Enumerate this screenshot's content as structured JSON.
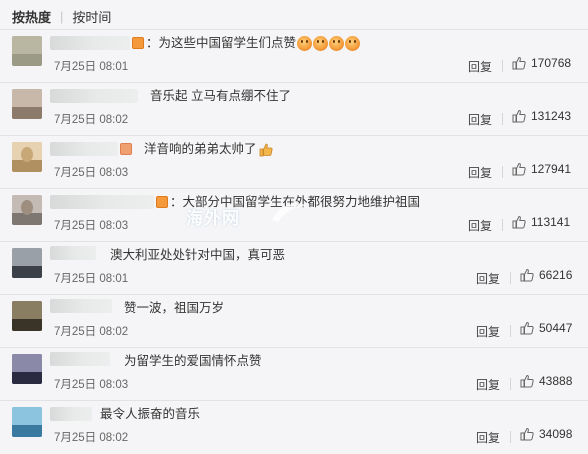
{
  "sort": {
    "hot_label": "按热度",
    "separator": "|",
    "time_label": "按时间"
  },
  "watermark": "海外网",
  "comments": [
    {
      "text": "：为这些中国留学生们点赞",
      "date": "7月25日",
      "time": "08:01",
      "reply": "回复",
      "likes": "170768"
    },
    {
      "text": "音乐起 立马有点绷不住了",
      "date": "7月25日",
      "time": "08:02",
      "reply": "回复",
      "likes": "131243"
    },
    {
      "text": "洋音响的弟弟太帅了",
      "date": "7月25日",
      "time": "08:03",
      "reply": "回复",
      "likes": "127941"
    },
    {
      "text": "：大部分中国留学生在外都很努力地维护祖国",
      "date": "7月25日",
      "time": "08:03",
      "reply": "回复",
      "likes": "113141"
    },
    {
      "text": "澳大利亚处处针对中国，真可恶",
      "date": "7月25日",
      "time": "08:01",
      "reply": "回复",
      "likes": "66216"
    },
    {
      "text": "赞一波，祖国万岁",
      "date": "7月25日",
      "time": "08:02",
      "reply": "回复",
      "likes": "50447"
    },
    {
      "text": "为留学生的爱国情怀点赞",
      "date": "7月25日",
      "time": "08:03",
      "reply": "回复",
      "likes": "43888"
    },
    {
      "text": "最令人振奋的音乐",
      "date": "7月25日",
      "time": "08:02",
      "reply": "回复",
      "likes": "34098"
    }
  ]
}
